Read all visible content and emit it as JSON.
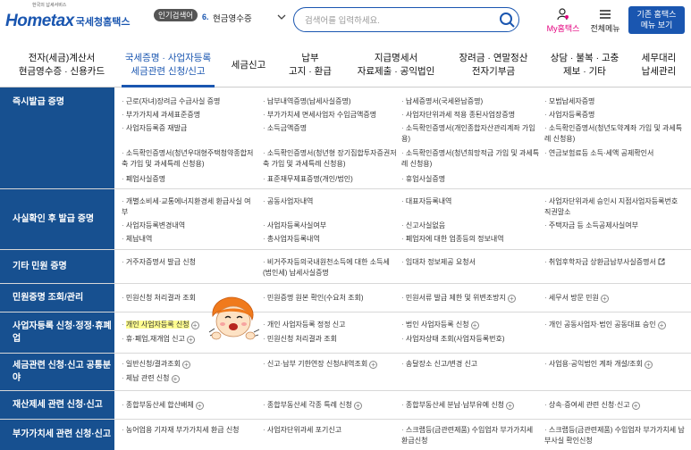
{
  "header": {
    "logo_sub": "한국의 납세서비스",
    "logo_word": "Hometax",
    "logo_kr": "국세청홈택스",
    "popular_badge": "인기검색어",
    "popular_num": "6.",
    "popular_term": "현금영수증",
    "search_placeholder": "검색어를 입력하세요.",
    "my_label": "My홈택스",
    "menu_label": "전체메뉴",
    "basic_btn_line1": "기존 홈택스",
    "basic_btn_line2": "메뉴 보기",
    "accent": "#1a56b0"
  },
  "nav": {
    "items": [
      {
        "line1": "전자(세금)계산서",
        "line2": "현금영수증 · 신용카드"
      },
      {
        "line1": "국세증명 · 사업자등록",
        "line2": "세금관련 신청/신고"
      },
      {
        "line1": "세금신고",
        "line2": ""
      },
      {
        "line1": "납부",
        "line2": "고지 · 환급"
      },
      {
        "line1": "지급명세서",
        "line2": "자료제출 · 공익법인"
      },
      {
        "line1": "장려금 · 연말정산",
        "line2": "전자기부금"
      },
      {
        "line1": "상담 · 불복 · 고충",
        "line2": "제보 · 기타"
      },
      {
        "line1": "세무대리",
        "line2": "납세관리"
      }
    ]
  },
  "rows": [
    {
      "title": "즉시발급 증명",
      "cells": [
        "근로(자녀)장려금 수급사실 증명",
        "납부내역증명(납세사실증명)",
        "납세증명서(국세완납증명)",
        "모범납세자증명",
        "부가가치세 과세표준증명",
        "부가가치세 면세사업자 수입금액증명",
        "사업자단위과세 적용 종된사업장증명",
        "사업자등록증명",
        "사업자등록증 재발급",
        "소득금액증명",
        "소득확인증명서(개인종합자산관리계좌 가입용)",
        "소득확인증명서(청년도약계좌 가입 및 과세특례 신청용)",
        "소득확인증명서(청년우대형주택청약종합저축 가입 및 과세특례 신청용)",
        "소득확인증명서(청년형 장기집합투자증권저축 가입 및 과세특례 신청용)",
        "소득확인증명서(청년희망적금 가입 및 과세특례 신청용)",
        "연금보험료등 소득·세액 공제확인서",
        "폐업사실증명",
        "표준재무제표증명(개인/법인)",
        "휴업사실증명"
      ]
    },
    {
      "title": "사실확인 후 발급 증명",
      "cells": [
        "개별소비세·교통에너지환경세 환급사실 여부",
        "공동사업자내역",
        "대표자등록내역",
        "사업자단위과세 승인시 지점사업자등록번호 직권말소",
        "사업자등록변경내역",
        "사업자등록사실여부",
        "신고사실없음",
        "주택자금 등 소득공제사실여부",
        "체납내역",
        "총사업자등록내역",
        "폐업자에 대한 업종등의 정보내역"
      ]
    },
    {
      "title": "기타 민원 증명",
      "cells": [
        "거주자증명서 발급 신청",
        "비거주자등의국내원천소득에 대한 소득세(법인세) 납세사실증명",
        "임대차 정보제공 요청서",
        "취업후학자금 상환금납부사실증명서"
      ]
    },
    {
      "title": "민원증명 조회/관리",
      "cells": [
        "민원신청 처리결과 조회",
        "민원증명 원본 확인(수요처 조회)",
        "민원서류 발급 제한 및 위변조방지",
        "세무서 방문 민원"
      ]
    },
    {
      "title": "사업자등록 신청·정정·휴폐업",
      "cells": [
        "개인 사업자등록 신청",
        "개인 사업자등록 정정 신고",
        "법인 사업자등록 신청",
        "개인 공동사업자·법인 공동대표 승인",
        "휴·폐업,재개업 신고",
        "민원신청 처리결과 조회",
        "사업자상태 조회(사업자등록번호)"
      ]
    },
    {
      "title": "세금관련 신청·신고 공통분야",
      "cells": [
        "일반신청/결과조회",
        "신고·납부 기한연장 신청/내역조회",
        "송달장소 신고/변경 신고",
        "사업용·공익법인 계좌 개설/조회",
        "체납 관련 신청"
      ]
    },
    {
      "title": "재산제세 관련 신청·신고",
      "cells": [
        "종합부동산세 합산배제",
        "종합부동산세 각종 특례 신청",
        "종합부동산세 분납·납부유예 신청",
        "상속·증여세 관련 신청·신고"
      ]
    },
    {
      "title": "부가가치세 관련 신청·신고",
      "cells": [
        "농어업용 기자재 부가가치세 환급 신청",
        "사업자단위과세 포기신고",
        "스크랩등(금관련제품) 수입업자 부가가치세 환급신청",
        "스크랩등(금관련제품) 수입업자 부가가치세 납부사실 확인신청"
      ]
    }
  ]
}
